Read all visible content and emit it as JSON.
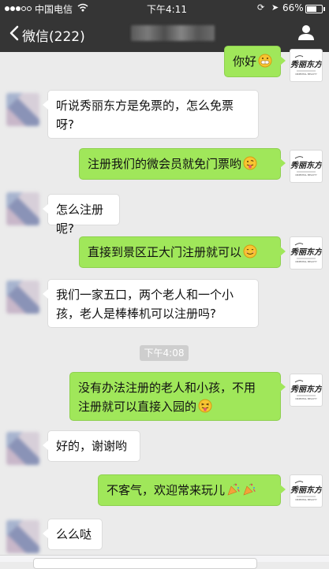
{
  "status_bar": {
    "carrier": "中国电信",
    "time": "下午4:11",
    "battery_percent": "66%",
    "battery_level": 0.66
  },
  "nav": {
    "back_label": "微信(222)"
  },
  "logo": {
    "text": "秀丽东方",
    "subtext": "ORIENTAL BEAUTY"
  },
  "messages": [
    {
      "side": "out",
      "lines": [
        "你好"
      ],
      "emoji": [
        "grin"
      ]
    },
    {
      "side": "in",
      "lines": [
        "听说秀丽东方是免票的，怎么免票",
        "呀?"
      ]
    },
    {
      "side": "out",
      "lines": [
        "注册我们的微会员就免门票哟"
      ],
      "emoji": [
        "tongue"
      ]
    },
    {
      "side": "in",
      "lines": [
        "怎么注册呢?"
      ]
    },
    {
      "side": "out",
      "lines": [
        "直接到景区正大门注册就可以"
      ],
      "emoji": [
        "smile"
      ]
    },
    {
      "side": "in",
      "lines": [
        "我们一家五口，两个老人和一个小",
        "孩，老人是棒棒机可以注册吗?"
      ]
    },
    {
      "side": "out",
      "lines": [
        "没有办法注册的老人和小孩，不用",
        "注册就可以直接入园的"
      ],
      "emoji": [
        "wink-tongue"
      ]
    },
    {
      "side": "in",
      "lines": [
        "好的，谢谢哟"
      ]
    },
    {
      "side": "out",
      "lines": [
        "不客气，欢迎常来玩儿"
      ],
      "emoji": [
        "party",
        "party"
      ]
    },
    {
      "side": "in",
      "lines": [
        "么么哒"
      ]
    }
  ],
  "timestamp": "下午4:08"
}
